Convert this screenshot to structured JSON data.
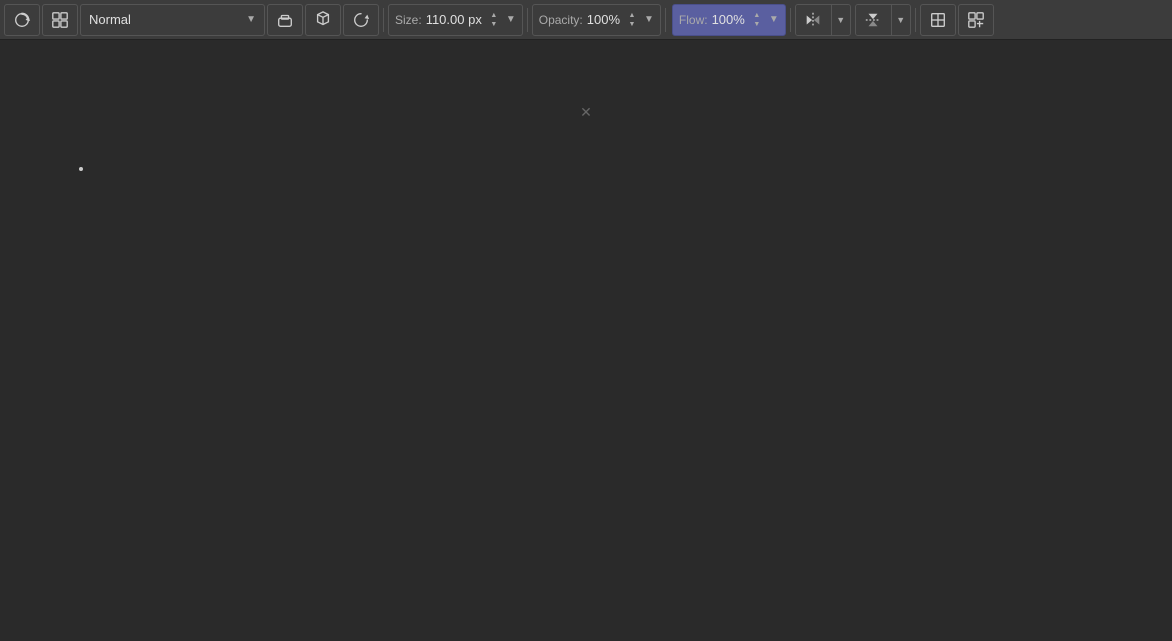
{
  "toolbar": {
    "mode_label": "Normal",
    "size_label": "Size:",
    "size_value": "110.00 px",
    "opacity_label": "Opacity:",
    "opacity_value": "100%",
    "flow_label": "Flow:",
    "flow_value": "100%"
  },
  "canvas": {
    "background_color": "#2a2a2a"
  },
  "icons": {
    "tool1": "⟳",
    "tool2": "⊞",
    "eraser": "◻",
    "clone": "✦",
    "reset": "↺",
    "mirror_h": "⇔",
    "mirror_v": "⇕",
    "wrap": "⊡",
    "symmetry": "⊟"
  }
}
